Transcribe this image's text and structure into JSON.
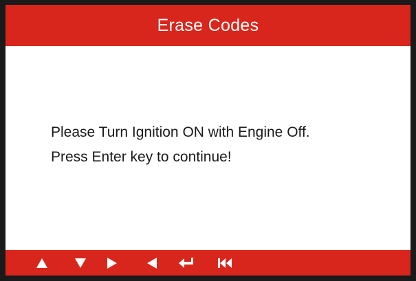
{
  "header": {
    "title": "Erase Codes"
  },
  "message": {
    "line1": "Please Turn Ignition ON with Engine Off.",
    "line2": "Press Enter key to continue!"
  },
  "keys": [
    {
      "icon": "up-arrow-icon"
    },
    {
      "icon": "down-arrow-icon"
    },
    {
      "icon": "right-arrow-icon"
    },
    {
      "icon": "left-arrow-icon"
    },
    {
      "icon": "enter-icon"
    },
    {
      "icon": "skip-back-icon"
    }
  ],
  "colors": {
    "bar": "#d9261c",
    "bar_text": "#ffffff",
    "body_text": "#1a1a1a",
    "screen": "#ffffff",
    "bezel": "#1a1a1a"
  }
}
